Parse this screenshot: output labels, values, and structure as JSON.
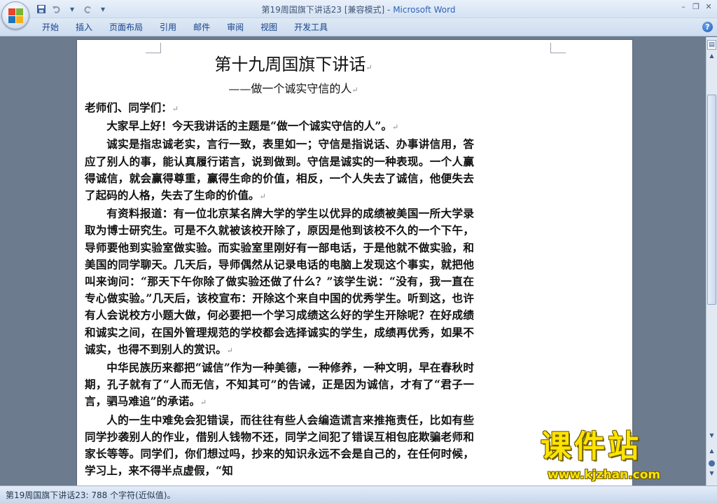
{
  "window": {
    "title": "第19周国旗下讲话23 [兼容模式] - ",
    "app_name": "Microsoft Word",
    "minimize": "–",
    "restore": "❐",
    "close": "✕"
  },
  "quick_access": {
    "undo_arrow": "▾",
    "customize": "▾"
  },
  "ribbon": {
    "tabs": [
      "开始",
      "插入",
      "页面布局",
      "引用",
      "邮件",
      "审阅",
      "视图",
      "开发工具"
    ],
    "help": "?"
  },
  "document": {
    "heading": "第十九周国旗下讲话",
    "subtitle": "——做一个诚实守信的人",
    "paragraphs": [
      "老师们、同学们：",
      "大家早上好！今天我讲话的主题是“做一个诚实守信的人”。",
      "诚实是指忠诚老实，言行一致，表里如一；守信是指说话、办事讲信用，答应了别人的事，能认真履行诺言，说到做到。守信是诚实的一种表现。一个人赢得诚信，就会赢得尊重，赢得生命的价值，相反，一个人失去了诚信，他便失去了起码的人格，失去了生命的价值。",
      "有资料报道：有一位北京某名牌大学的学生以优异的成绩被美国一所大学录取为博士研究生。可是不久就被该校开除了，原因是他到该校不久的一个下午，导师要他到实验室做实验。而实验室里刚好有一部电话，于是他就不做实验，和美国的同学聊天。几天后，导师偶然从记录电话的电脑上发现这个事实，就把他叫来询问：“那天下午你除了做实验还做了什么？”该学生说：“没有，我一直在专心做实验。”几天后，该校宣布：开除这个来自中国的优秀学生。听到这，也许有人会说校方小题大做，何必要把一个学习成绩这么好的学生开除呢？在好成绩和诚实之间，在国外管理规范的学校都会选择诚实的学生，成绩再优秀，如果不诚实，也得不到别人的赏识。",
      "中华民族历来都把“诚信”作为一种美德，一种修养，一种文明，早在春秋时期，孔子就有了“人而无信，不知其可”的告诫，正是因为诚信，才有了“君子一言，驷马难追”的承诺。",
      "人的一生中难免会犯错误，而往往有些人会编造谎言来推拖责任，比如有些同学抄袭别人的作业，借别人钱物不还，同学之间犯了错误互相包庇欺骗老师和家长等等。同学们，你们想过吗，抄来的知识永远不会是自己的，在任何时候，学习上，来不得半点虚假，“知"
    ],
    "paragraph_mark": "↵"
  },
  "statusbar": {
    "text": "第19周国旗下讲话23: 788 个字符(近似值)。"
  },
  "watermark": {
    "title": "课件站",
    "url": "www.kjzhan.com"
  },
  "colors": {
    "office_logo": [
      "#e8452c",
      "#7ab533",
      "#1c75bc",
      "#f6b11a"
    ],
    "watermark": "#ffe400"
  }
}
